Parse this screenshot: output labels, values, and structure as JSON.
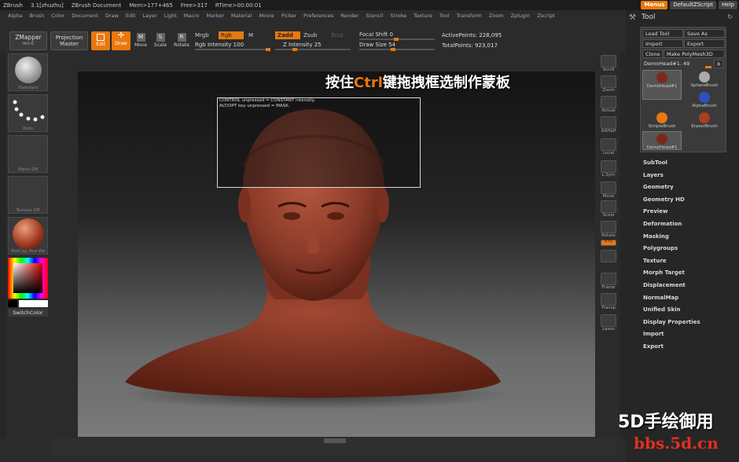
{
  "titlebar": {
    "app": "ZBrush",
    "version": "3.1[zhuzhu]",
    "document": "ZBrush Document",
    "mem": "Mem>177+465",
    "free": "Free>317",
    "rtime": "RTime>00:00:01",
    "menus_btn": "Menus",
    "zscript_btn": "DefaultZScript",
    "help_btn": "Help"
  },
  "menubar": [
    "Alpha",
    "Brush",
    "Color",
    "Document",
    "Draw",
    "Edit",
    "Layer",
    "Light",
    "Macro",
    "Marker",
    "Material",
    "Movie",
    "Picker",
    "Preferences",
    "Render",
    "Stencil",
    "Stroke",
    "Texture",
    "Tool",
    "Transform",
    "Zoom",
    "Zplugin",
    "Zscript"
  ],
  "toolbar": {
    "zmapper": "ZMapper",
    "zmapper_sub": "rev-E",
    "projection": "Projection",
    "master": "Master",
    "edit": "Edit",
    "draw": "Draw",
    "move": "Move",
    "scale": "Scale",
    "rotate": "Rotate",
    "mrgb": "Mrgb",
    "rgb": "Rgb",
    "m": "M",
    "rgb_intensity": "Rgb Intensity 100",
    "zadd": "Zadd",
    "zsub": "Zsub",
    "zcut": "Zcut",
    "z_intensity": "Z Intensity 25",
    "focal_shift": "Focal Shift 0",
    "draw_size": "Draw Size 54",
    "active_points": "ActivePoints: 228,095",
    "total_points": "TotalPoints: 923,017"
  },
  "leftshelf": {
    "standard": "Standard",
    "dots": "Dots",
    "alpha": "Alpha Off",
    "texture": "Texture Off",
    "matcap": "MatCap Red Wa",
    "switch_color": "SwitchColor"
  },
  "righttray": [
    "Scroll",
    "Zoom",
    "Actual",
    "AAHalf",
    "Local",
    "L.Sym",
    "Move",
    "Scale",
    "Rotate",
    "XYZ",
    "",
    "Frame",
    "Transp",
    "Lasso"
  ],
  "viewport": {
    "hud_line1": "CONTROL unpressed = CONSTANT intensity.",
    "hud_line2": "ALT/OPT key unpressed = MASK.",
    "caption_pre": "按住",
    "caption_key": "Ctrl",
    "caption_post": "键拖拽框选制作蒙板"
  },
  "tool_panel": {
    "title": "Tool",
    "load_tool": "Load Tool",
    "save_as": "Save As",
    "import": "Import",
    "export": "Export",
    "clone": "Clone",
    "make_polymesh": "Make PolyMesh3D",
    "current_tool": "DemoHead#1. 49",
    "r_btn": "R",
    "thumbs": [
      "DemoHead#1",
      "SphereBrush",
      "AlphaBrush",
      "SimpleBrush",
      "EraserBrush",
      "DemoHead#1"
    ],
    "subpalettes": [
      "SubTool",
      "Layers",
      "Geometry",
      "Geometry HD",
      "Preview",
      "Deformation",
      "Masking",
      "Polygroups",
      "Texture",
      "Morph Target",
      "Displacement",
      "NormalMap",
      "Unified Skin",
      "Display Properties",
      "Import",
      "Export"
    ]
  },
  "watermark": {
    "line1": "5D手绘御用",
    "line2": "bbs.5d.cn"
  },
  "colors": {
    "accent": "#e8780f",
    "skin": "#8a3a28",
    "watermark_red": "#e03020"
  }
}
